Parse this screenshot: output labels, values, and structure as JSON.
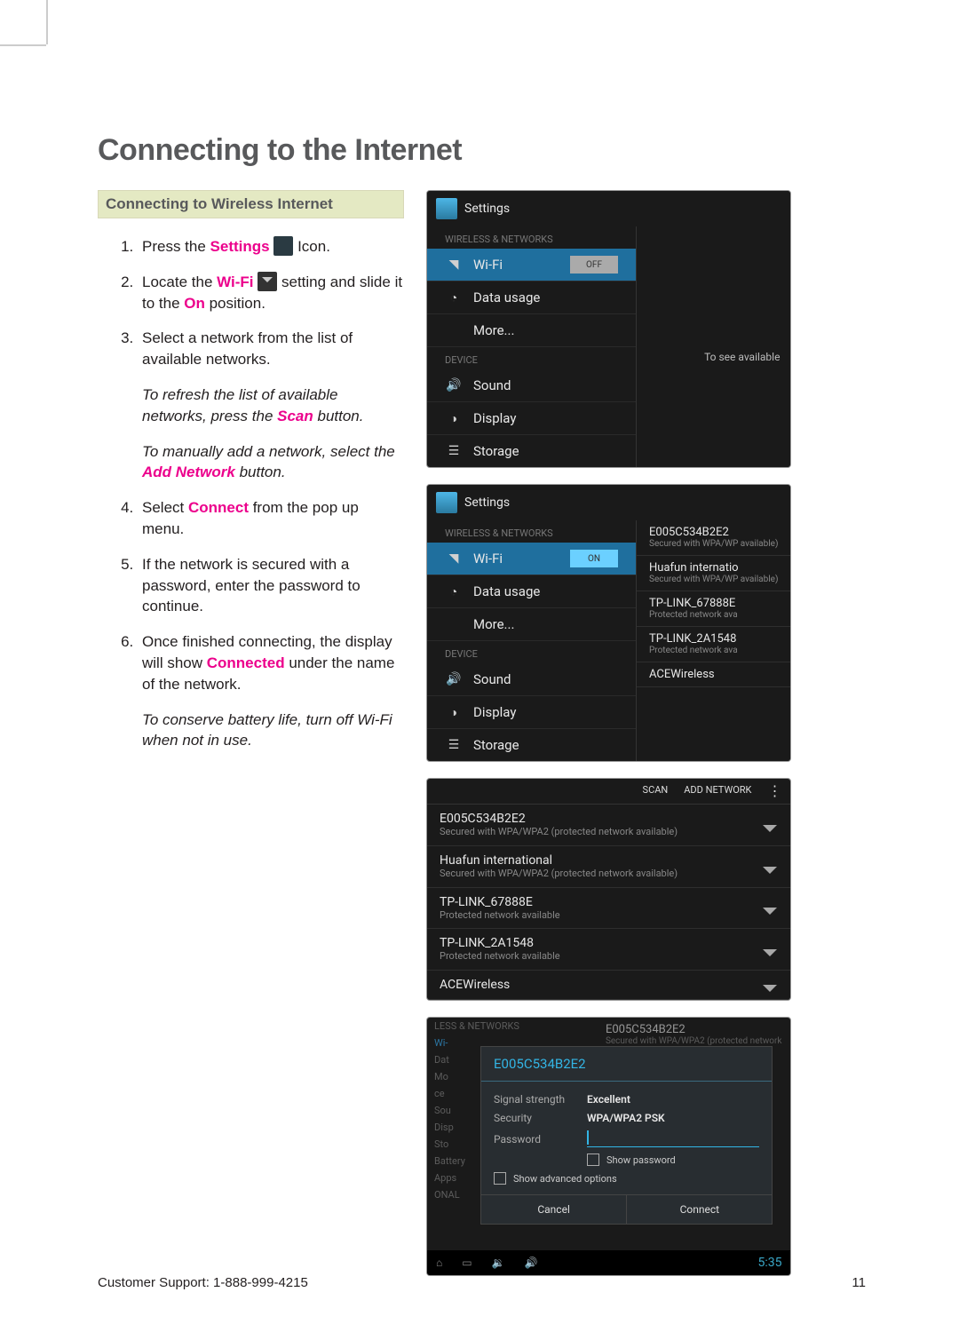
{
  "title": "Connecting to the Internet",
  "subheading": "Connecting to Wireless Internet",
  "steps": {
    "s1a": "Press the ",
    "s1k": "Settings",
    "s1b": " Icon.",
    "s2a": "Locate the ",
    "s2k": "Wi-Fi",
    "s2b": " setting and slide it to the ",
    "s2k2": "On",
    "s2c": " position.",
    "s3": "Select a network from the list of available networks.",
    "note1a": "To refresh the list of available networks, press the ",
    "note1k": "Scan",
    "note1b": " button.",
    "note2a": "To manually add a network, select the ",
    "note2k": "Add Network",
    "note2b": " button.",
    "s4a": "Select ",
    "s4k": "Connect",
    "s4b": " from the pop up menu.",
    "s5": "If the network is secured with a password, enter the password to continue.",
    "s6a": "Once finished connecting, the display will show ",
    "s6k": "Connected",
    "s6b": " under the name of the network.",
    "note3": "To conserve battery life, turn off Wi-Fi when not in use."
  },
  "ss1": {
    "settings": "Settings",
    "cat_wireless": "WIRELESS & NETWORKS",
    "wifi": "Wi-Fi",
    "wifi_state": "OFF",
    "data_usage": "Data usage",
    "more": "More...",
    "cat_device": "DEVICE",
    "sound": "Sound",
    "display": "Display",
    "storage": "Storage",
    "hint": "To see available"
  },
  "ss2": {
    "settings": "Settings",
    "cat_wireless": "WIRELESS & NETWORKS",
    "wifi": "Wi-Fi",
    "wifi_state": "ON",
    "data_usage": "Data usage",
    "more": "More...",
    "cat_device": "DEVICE",
    "sound": "Sound",
    "display": "Display",
    "storage": "Storage",
    "nets": [
      {
        "n": "E005C534B2E2",
        "d": "Secured with WPA/WP available)"
      },
      {
        "n": "Huafun internatio",
        "d": "Secured with WPA/WP available)"
      },
      {
        "n": "TP-LINK_67888E",
        "d": "Protected network ava"
      },
      {
        "n": "TP-LINK_2A1548",
        "d": "Protected network ava"
      },
      {
        "n": "ACEWireless",
        "d": ""
      }
    ]
  },
  "ss3": {
    "scan": "SCAN",
    "add": "ADD NETWORK",
    "nets": [
      {
        "n": "E005C534B2E2",
        "d": "Secured with WPA/WPA2 (protected network available)"
      },
      {
        "n": "Huafun international",
        "d": "Secured with WPA/WPA2 (protected network available)"
      },
      {
        "n": "TP-LINK_67888E",
        "d": "Protected network available"
      },
      {
        "n": "TP-LINK_2A1548",
        "d": "Protected network available"
      },
      {
        "n": "ACEWireless",
        "d": ""
      }
    ]
  },
  "ss4": {
    "bg_header": "LESS & NETWORKS",
    "bg_items": [
      "Wi-",
      "Dat",
      "Mo",
      "ce",
      "Sou",
      "Disp",
      "Sto",
      "Battery",
      "Apps",
      "ONAL"
    ],
    "bg_net": "E005C534B2E2",
    "bg_net_d": "Secured with WPA/WPA2 (protected network",
    "dlg_title": "E005C534B2E2",
    "sig_label": "Signal strength",
    "sig_val": "Excellent",
    "sec_label": "Security",
    "sec_val": "WPA/WPA2 PSK",
    "pwd_label": "Password",
    "show_pwd": "Show password",
    "show_adv": "Show advanced options",
    "cancel": "Cancel",
    "connect": "Connect",
    "clock": "5:35"
  },
  "footer": {
    "support": "Customer Support: 1-888-999-4215",
    "page": "11"
  }
}
